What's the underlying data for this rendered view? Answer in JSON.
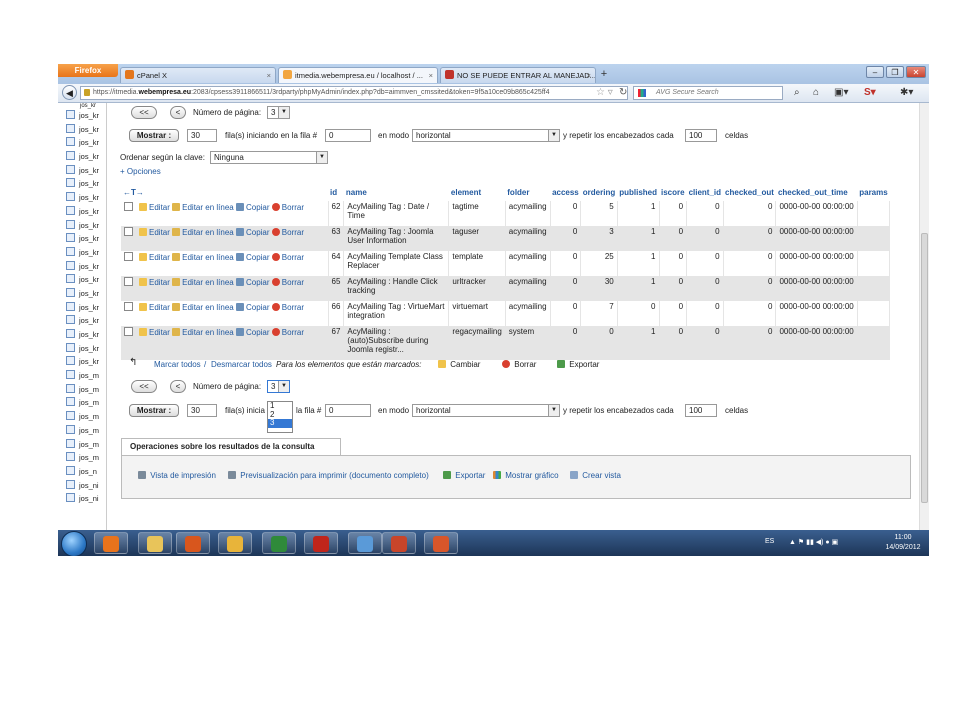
{
  "browser": {
    "menu_button": "Firefox",
    "tabs": [
      {
        "label": "cPanel X",
        "icon_color": "#e3761c",
        "active": false
      },
      {
        "label": "itmedia.webempresa.eu / localhost / ...",
        "icon_color": "#f2a640",
        "active": true
      },
      {
        "label": "NO SE PUEDE ENTRAR AL MANEJAD...",
        "icon_color": "#c0322b",
        "active": false
      }
    ],
    "new_tab": "+",
    "url_prefix": "https://itmedia.",
    "url_domain": "webempresa.eu",
    "url_rest": ":2083/cpsess3911866511/3rdparty/phpMyAdmin/index.php?db=aimmven_cmssited&token=9f5a10ce09b865c425ff4",
    "search_placeholder": "AVG Secure Search"
  },
  "sidebar": {
    "items": [
      "jos_kr",
      "jos_kr",
      "jos_kr",
      "jos_kr",
      "jos_kr",
      "jos_kr",
      "jos_kr",
      "jos_kr",
      "jos_kr",
      "jos_kr",
      "jos_kr",
      "jos_kr",
      "jos_kr",
      "jos_kr",
      "jos_kr",
      "jos_kr",
      "jos_kr",
      "jos_kr",
      "jos_kr",
      "jos_m",
      "jos_m",
      "jos_m",
      "jos_m",
      "jos_m",
      "jos_m",
      "jos_m",
      "jos_n",
      "jos_ni",
      "jos_ni"
    ],
    "top_item": "jos_kr"
  },
  "pager_top": {
    "first": "<<",
    "prev": "<",
    "label": "Número de página:",
    "value": "3"
  },
  "show_row_top": {
    "button": "Mostrar :",
    "rows": "30",
    "rows_label": "fila(s) iniciando en la fila #",
    "start": "0",
    "mode_label": "en modo",
    "mode": "horizontal",
    "repeat_label": "y repetir los encabezados cada",
    "repeat": "100",
    "cells_label": "celdas"
  },
  "sort": {
    "label": "Ordenar según la clave:",
    "value": "Ninguna"
  },
  "options_link": "+ Opciones",
  "arrows": "←T→",
  "table": {
    "columns": [
      "id",
      "name",
      "element",
      "folder",
      "access",
      "ordering",
      "published",
      "iscore",
      "client_id",
      "checked_out",
      "checked_out_time",
      "params"
    ],
    "actions": {
      "edit": "Editar",
      "inline": "Editar en línea",
      "copy": "Copiar",
      "delete": "Borrar"
    },
    "rows": [
      {
        "id": "62",
        "name": "AcyMailing Tag : Date / Time",
        "element": "tagtime",
        "folder": "acymailing",
        "access": "0",
        "ordering": "5",
        "published": "1",
        "iscore": "0",
        "client_id": "0",
        "checked_out": "0",
        "checked_out_time": "0000-00-00 00:00:00"
      },
      {
        "id": "63",
        "name": "AcyMailing Tag : Joomla User Information",
        "element": "taguser",
        "folder": "acymailing",
        "access": "0",
        "ordering": "3",
        "published": "1",
        "iscore": "0",
        "client_id": "0",
        "checked_out": "0",
        "checked_out_time": "0000-00-00 00:00:00"
      },
      {
        "id": "64",
        "name": "AcyMailing Template Class Replacer",
        "element": "template",
        "folder": "acymailing",
        "access": "0",
        "ordering": "25",
        "published": "1",
        "iscore": "0",
        "client_id": "0",
        "checked_out": "0",
        "checked_out_time": "0000-00-00 00:00:00"
      },
      {
        "id": "65",
        "name": "AcyMailing : Handle Click tracking",
        "element": "urltracker",
        "folder": "acymailing",
        "access": "0",
        "ordering": "30",
        "published": "1",
        "iscore": "0",
        "client_id": "0",
        "checked_out": "0",
        "checked_out_time": "0000-00-00 00:00:00"
      },
      {
        "id": "66",
        "name": "AcyMailing Tag : VirtueMart integration",
        "element": "virtuemart",
        "folder": "acymailing",
        "access": "0",
        "ordering": "7",
        "published": "0",
        "iscore": "0",
        "client_id": "0",
        "checked_out": "0",
        "checked_out_time": "0000-00-00 00:00:00"
      },
      {
        "id": "67",
        "name": "AcyMailing : (auto)Subscribe during Joomla registr...",
        "element": "regacymailing",
        "folder": "system",
        "access": "0",
        "ordering": "0",
        "published": "1",
        "iscore": "0",
        "client_id": "0",
        "checked_out": "0",
        "checked_out_time": "0000-00-00 00:00:00"
      }
    ]
  },
  "mark_bar": {
    "mark_all": "Marcar todos",
    "sep": "/",
    "unmark_all": "Desmarcar todos",
    "for_marked": "Para los elementos que están marcados:",
    "change": "Cambiar",
    "delete": "Borrar",
    "export": "Exportar"
  },
  "pager_bottom": {
    "first": "<<",
    "prev": "<",
    "label": "Número de página:",
    "value": "3",
    "options": [
      "1",
      "2",
      "3"
    ]
  },
  "show_row_bottom": {
    "button": "Mostrar :",
    "rows": "30",
    "rows_label_a": "fila(s) inicia",
    "rows_label_b": "la fila #",
    "start": "0",
    "mode_label": "en modo",
    "mode": "horizontal",
    "repeat_label": "y repetir los encabezados cada",
    "repeat": "100",
    "cells_label": "celdas"
  },
  "operations": {
    "title": "Operaciones sobre los resultados de la consulta",
    "print_view": "Vista de impresión",
    "print_preview": "Previsualización para imprimir (documento completo)",
    "export": "Exportar",
    "chart": "Mostrar gráfico",
    "create_view": "Crear vista"
  },
  "taskbar": {
    "lang": "ES",
    "time": "11:00",
    "date": "14/09/2012",
    "apps": [
      {
        "name": "media-player",
        "color": "#e8731c"
      },
      {
        "name": "file-explorer",
        "color": "#e8c45a"
      },
      {
        "name": "firefox",
        "color": "#d8561d"
      },
      {
        "name": "outlook",
        "color": "#e8b43a"
      },
      {
        "name": "excel",
        "color": "#2f8a3a"
      },
      {
        "name": "filezilla",
        "color": "#c0251b"
      },
      {
        "name": "editor",
        "color": "#5a9ad8"
      },
      {
        "name": "powerpoint-1",
        "color": "#c8452a"
      },
      {
        "name": "powerpoint-2",
        "color": "#d8562a"
      }
    ]
  }
}
